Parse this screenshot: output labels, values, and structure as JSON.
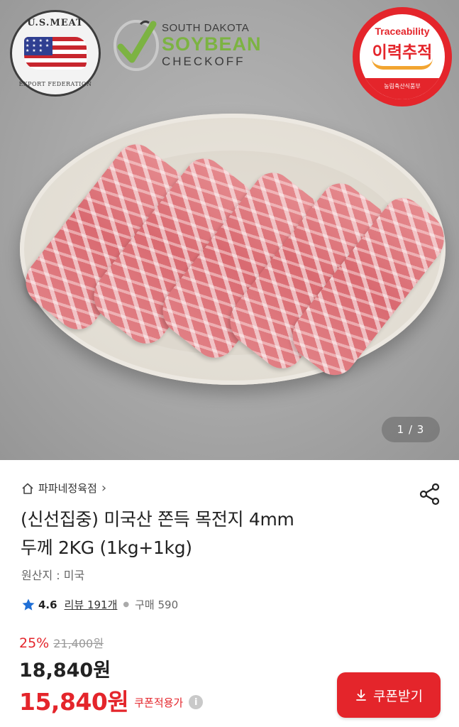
{
  "hero": {
    "logos": {
      "usmef_top": "U.S.MEAT",
      "usmef_bottom": "EXPORT FEDERATION",
      "soy_line1": "SOUTH DAKOTA",
      "soy_line2": "SOYBEAN",
      "soy_line3": "CHECKOFF",
      "trace_en": "Traceability",
      "trace_ko": "이력추적",
      "trace_band": "농림축산식품부"
    },
    "pager": "1 / 3"
  },
  "store": {
    "name": "파파네정육점",
    "chevron": "›"
  },
  "product": {
    "title_line1": "(신선집중) 미국산 쫀득 목전지 4mm",
    "title_line2": "두께 2KG (1kg+1kg)",
    "origin": "원산지 : 미국"
  },
  "rating": {
    "score": "4.6",
    "review_label": "리뷰 191개",
    "purchase_label": "구매 590"
  },
  "price": {
    "discount_pct": "25%",
    "original": "21,400원",
    "sale": "18,840원",
    "coupon_price": "15,840원",
    "coupon_note": "쿠폰적용가",
    "info_glyph": "i"
  },
  "actions": {
    "coupon_button": "쿠폰받기"
  },
  "colors": {
    "accent_red": "#e4252b",
    "rating_star": "#1f6fd6",
    "soy_green": "#7cb342"
  },
  "icons": {
    "store": "home-icon",
    "share": "share-icon",
    "star": "star-icon",
    "download": "download-arrow-icon",
    "info": "info-icon"
  }
}
